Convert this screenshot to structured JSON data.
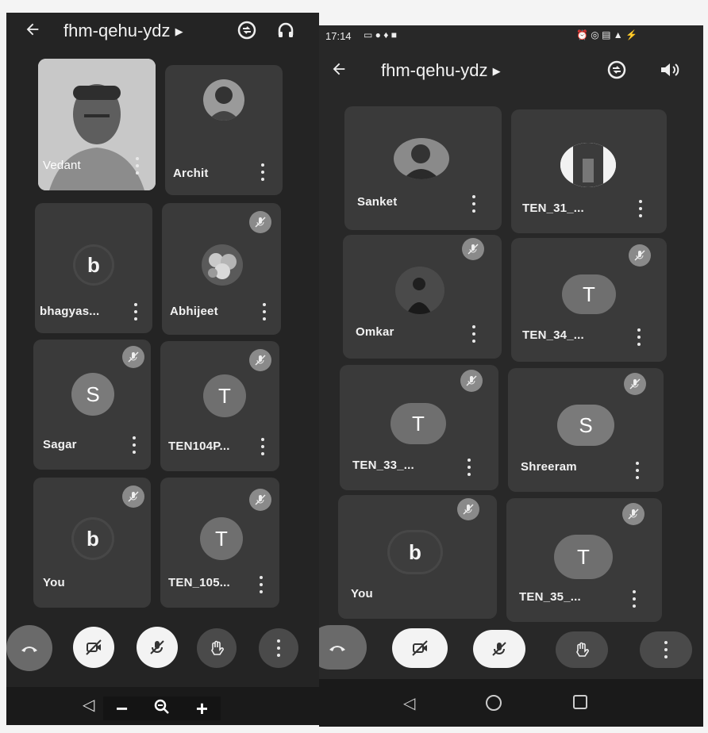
{
  "left_screen": {
    "meeting_code": "fhm-qehu-ydz",
    "participants": [
      {
        "name": "Vedant",
        "avatar": "photo-video",
        "muted": false
      },
      {
        "name": "Archit",
        "avatar": "photo",
        "muted": false
      },
      {
        "name": "bhagyas...",
        "avatar": "b",
        "muted": false
      },
      {
        "name": "Abhijeet",
        "avatar": "photo-flowers",
        "muted": true
      },
      {
        "name": "Sagar",
        "avatar": "S",
        "muted": true
      },
      {
        "name": "TEN104P...",
        "avatar": "T",
        "muted": true
      },
      {
        "name": "You",
        "avatar": "b",
        "muted": true
      },
      {
        "name": "TEN_105...",
        "avatar": "T",
        "muted": true
      }
    ],
    "zoom_controls": {
      "minus": "−",
      "plus": "+"
    }
  },
  "right_screen": {
    "status_time": "17:14",
    "meeting_code": "fhm-qehu-ydz",
    "participants": [
      {
        "name": "Sanket",
        "avatar": "photo",
        "muted": false
      },
      {
        "name": "TEN_31_...",
        "avatar": "photo-landscape",
        "muted": false
      },
      {
        "name": "Omkar",
        "avatar": "photo-dark",
        "muted": true
      },
      {
        "name": "TEN_34_...",
        "avatar": "T",
        "muted": true
      },
      {
        "name": "TEN_33_...",
        "avatar": "T",
        "muted": true
      },
      {
        "name": "Shreeram",
        "avatar": "S",
        "muted": true
      },
      {
        "name": "You",
        "avatar": "b",
        "muted": true
      },
      {
        "name": "TEN_35_...",
        "avatar": "T",
        "muted": true
      }
    ]
  },
  "icons": {
    "back": "arrow-left-icon",
    "title_chevron": "caret-right-icon",
    "switch_camera": "switch-camera-icon",
    "audio_output_left": "headphones-icon",
    "audio_output_right": "speaker-icon",
    "end_call": "phone-hangup-icon",
    "camera_off": "video-off-icon",
    "mic_off": "mic-off-icon",
    "raise_hand": "hand-icon",
    "more": "more-vert-icon"
  },
  "colors": {
    "background": "#252525",
    "tile": "#3a3a3a",
    "mute_badge": "#8a8a8a",
    "end_call": "#6a6a6a",
    "control_white": "#f3f3f3"
  }
}
